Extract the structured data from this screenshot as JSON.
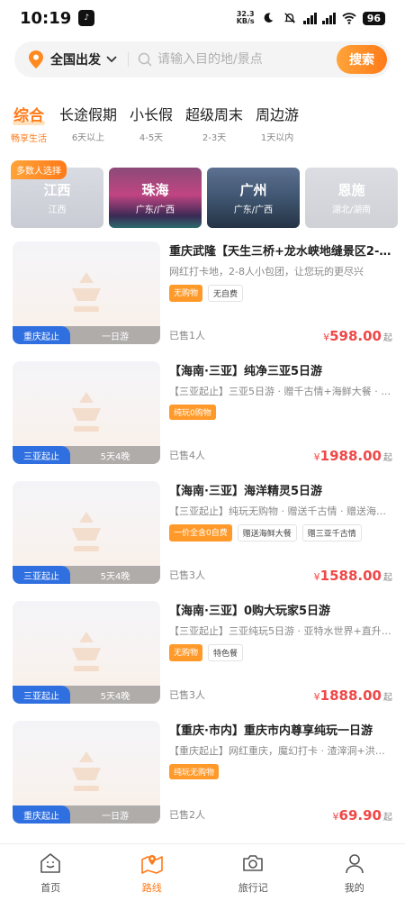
{
  "status_bar": {
    "time": "10:19",
    "speed_value": "32.3",
    "speed_unit": "KB/s",
    "battery": "96"
  },
  "search": {
    "location": "全国出发",
    "placeholder": "请输入目的地/景点",
    "button": "搜索"
  },
  "tabs": [
    {
      "title": "综合",
      "sub": "畅享生活",
      "active": true
    },
    {
      "title": "长途假期",
      "sub": "6天以上"
    },
    {
      "title": "小长假",
      "sub": "4-5天"
    },
    {
      "title": "超级周末",
      "sub": "2-3天"
    },
    {
      "title": "周边游",
      "sub": "1天以内"
    }
  ],
  "popular_badge": "多数人选择",
  "destinations": [
    {
      "name": "江西",
      "sub": "江西"
    },
    {
      "name": "珠海",
      "sub": "广东/广西"
    },
    {
      "name": "广州",
      "sub": "广东/广西"
    },
    {
      "name": "恩施",
      "sub": "湖北/湖南"
    }
  ],
  "products": [
    {
      "title": "重庆武隆【天生三桥+龙水峡地缝景区2-8...",
      "subtitle": "网红打卡地，2-8人小包团，让您玩的更尽兴",
      "tags": [
        "无购物",
        "无自费"
      ],
      "origin": "重庆起止",
      "duration": "一日游",
      "sold": "已售1人",
      "currency": "¥",
      "price": "598.00",
      "price_suffix": "起"
    },
    {
      "title": "【海南·三亚】纯净三亚5日游",
      "subtitle": "【三亚起止】三亚5日游 · 赠千古情+海鲜大餐 · 蜈支洲...",
      "tags": [
        "纯玩0购物"
      ],
      "origin": "三亚起止",
      "duration": "5天4晚",
      "sold": "已售4人",
      "currency": "¥",
      "price": "1988.00",
      "price_suffix": "起"
    },
    {
      "title": "【海南·三亚】海洋精灵5日游",
      "subtitle": "【三亚起止】纯玩无购物 · 赠送千古情 · 赠送海鲜大餐 · ...",
      "tags": [
        "一价全含0自费",
        "赠送海鲜大餐",
        "赠三亚千古情"
      ],
      "origin": "三亚起止",
      "duration": "5天4晚",
      "sold": "已售3人",
      "currency": "¥",
      "price": "1588.00",
      "price_suffix": "起"
    },
    {
      "title": "【海南·三亚】0购大玩家5日游",
      "subtitle": "【三亚起止】三亚纯玩5日游 · 亚特水世界+直升机飞...",
      "tags": [
        "无购物",
        "特色餐"
      ],
      "origin": "三亚起止",
      "duration": "5天4晚",
      "sold": "已售3人",
      "currency": "¥",
      "price": "1888.00",
      "price_suffix": "起"
    },
    {
      "title": "【重庆·市内】重庆市内尊享纯玩一日游",
      "subtitle": "【重庆起止】网红重庆，魔幻打卡 · 渣滓洞+洪崖洞+...",
      "tags": [
        "纯玩无购物"
      ],
      "origin": "重庆起止",
      "duration": "一日游",
      "sold": "已售2人",
      "currency": "¥",
      "price": "69.90",
      "price_suffix": "起"
    }
  ],
  "bottom_nav": [
    {
      "label": "首页",
      "icon": "home-icon"
    },
    {
      "label": "路线",
      "icon": "route-map-icon",
      "active": true
    },
    {
      "label": "旅行记",
      "icon": "camera-icon"
    },
    {
      "label": "我的",
      "icon": "profile-icon"
    }
  ],
  "colors": {
    "accent": "#ff7a18",
    "price": "#f04848",
    "origin_tag": "#2f6fe0"
  }
}
